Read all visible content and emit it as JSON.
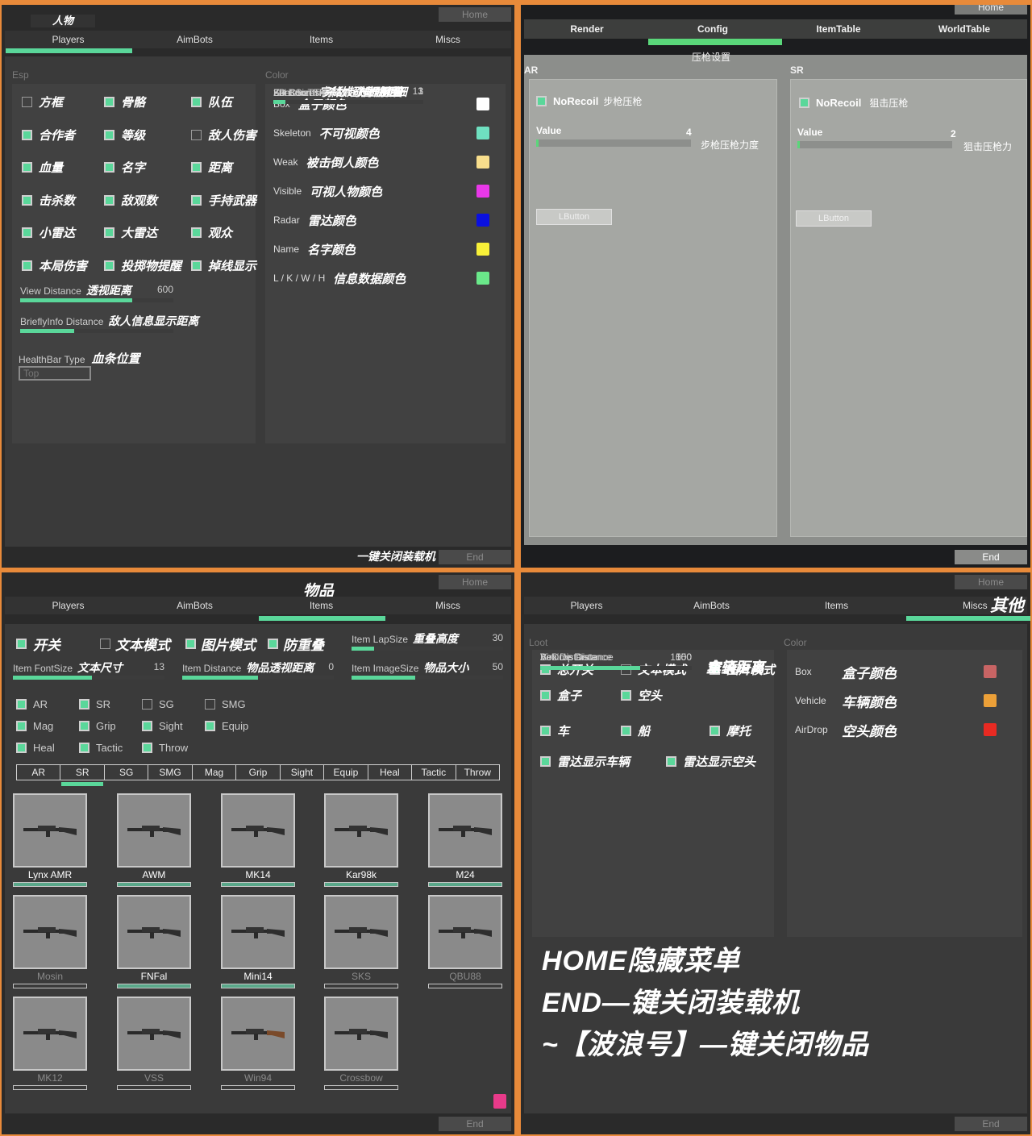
{
  "colors": {
    "accent": "#5ad79a",
    "frame": "#e88a3a",
    "background": "#2a2a2a"
  },
  "players_panel": {
    "title_cn": "人物",
    "home_label": "Home",
    "end_label": "End",
    "end_hint_cn": "一键关闭装载机",
    "tabs": [
      "Players",
      "AimBots",
      "Items",
      "Misc"
    ],
    "active_tab": "Players",
    "esp_label": "Esp",
    "color_label": "Color",
    "esp_checks": [
      {
        "label": "方框",
        "checked": false
      },
      {
        "label": "骨骼",
        "checked": true
      },
      {
        "label": "队伍",
        "checked": true
      },
      {
        "label": "合作者",
        "checked": true
      },
      {
        "label": "等级",
        "checked": true
      },
      {
        "label": "敌人伤害",
        "checked": false
      },
      {
        "label": "血量",
        "checked": true
      },
      {
        "label": "名字",
        "checked": true
      },
      {
        "label": "距离",
        "checked": true
      },
      {
        "label": "击杀数",
        "checked": true
      },
      {
        "label": "敌观数",
        "checked": true
      },
      {
        "label": "手持武器",
        "checked": true
      },
      {
        "label": "小雷达",
        "checked": true
      },
      {
        "label": "大雷达",
        "checked": true
      },
      {
        "label": "观众",
        "checked": true
      },
      {
        "label": "本局伤害",
        "checked": true
      },
      {
        "label": "投掷物提醒",
        "checked": true
      },
      {
        "label": "掉线显示",
        "checked": true
      }
    ],
    "esp_sliders": [
      {
        "label": "View Distance",
        "label_cn": "透视距离",
        "value": "600",
        "fill": 0.73
      },
      {
        "label": "BrieflyInfo Distance",
        "label_cn": "敌人信息显示距离",
        "value": "",
        "fill": 0.35
      }
    ],
    "healthbar": {
      "label": "HealthBar Type",
      "label_cn": "血条位置",
      "value": "Top"
    },
    "color_rows": [
      {
        "label": "Box",
        "label_cn": "盒子颜色",
        "color": "#ffffff"
      },
      {
        "label": "Skeleton",
        "label_cn": "不可视颜色",
        "color": "#6fe0c0"
      },
      {
        "label": "Weak",
        "label_cn": "被击倒人颜色",
        "color": "#f8de8c"
      },
      {
        "label": "Visible",
        "label_cn": "可视人物颜色",
        "color": "#e838e8"
      },
      {
        "label": "Radar",
        "label_cn": "雷达颜色",
        "color": "#0a10e0"
      },
      {
        "label": "Name",
        "label_cn": "名字颜色",
        "color": "#f8f038"
      },
      {
        "label": "L / K / W / H",
        "label_cn": "信息数据颜色",
        "color": "#6ae88a"
      }
    ],
    "color_sliders": [
      {
        "label": "Font Size",
        "label_cn": "字体大小",
        "value": "13",
        "fill": 0.65
      },
      {
        "label": "2D Box Thickness",
        "label_cn": "方框粗细",
        "value": "1",
        "fill": 0.01
      },
      {
        "label": "Skeleton Thickness",
        "label_cn": "骨骼粗细",
        "value": "1",
        "fill": 0.01
      },
      {
        "label": "Kill Counts",
        "label_cn": "杀敌超过几预警",
        "value": "3",
        "fill": 0.08
      }
    ]
  },
  "config_panel": {
    "home_label": "Home",
    "end_label": "End",
    "tabs": [
      "Render",
      "Config",
      "ItemTable",
      "WorldTable"
    ],
    "active_tab": "Config",
    "section_cn": "压枪设置",
    "groups": [
      {
        "title": "AR",
        "check_label": "NoRecoil",
        "check_cn": "步枪压枪",
        "checked": true,
        "value_label": "Value",
        "value": "4",
        "value_cn": "步枪压枪力度",
        "fill": 0.01,
        "button": "LButton"
      },
      {
        "title": "SR",
        "check_label": "NoRecoil",
        "check_cn": "狙击压枪",
        "checked": true,
        "value_label": "Value",
        "value": "2",
        "value_cn": "狙击压枪力",
        "fill": 0.01,
        "button": "LButton"
      }
    ]
  },
  "items_panel": {
    "title_cn": "物品",
    "home_label": "Home",
    "end_label": "End",
    "tabs": [
      "Players",
      "AimBots",
      "Items",
      "Miscs"
    ],
    "active_tab": "Items",
    "top_checks": [
      {
        "label": "开关",
        "checked": true
      },
      {
        "label": "文本模式",
        "checked": false
      },
      {
        "label": "图片模式",
        "checked": true
      },
      {
        "label": "防重叠",
        "checked": true
      }
    ],
    "sliders": [
      {
        "label": "Item LapSize",
        "label_cn": "重叠高度",
        "value": "30",
        "fill": 0.15
      },
      {
        "label": "Item FontSize",
        "label_cn": "文本尺寸",
        "value": "13",
        "fill": 0.52
      },
      {
        "label": "Item Distance",
        "label_cn": "物品透视距离",
        "value": "0",
        "fill": 0.5
      },
      {
        "label": "Item ImageSize",
        "label_cn": "物品大小",
        "value": "50",
        "fill": 0.42
      }
    ],
    "category_checks": [
      {
        "label": "AR",
        "checked": true
      },
      {
        "label": "SR",
        "checked": true
      },
      {
        "label": "SG",
        "checked": false
      },
      {
        "label": "SMG",
        "checked": false
      },
      {
        "label": "Mag",
        "checked": true
      },
      {
        "label": "Grip",
        "checked": true
      },
      {
        "label": "Sight",
        "checked": true
      },
      {
        "label": "Equip",
        "checked": true
      },
      {
        "label": "Heal",
        "checked": true
      },
      {
        "label": "Tactic",
        "checked": true
      },
      {
        "label": "Throw",
        "checked": true
      }
    ],
    "category_tabs": [
      "AR",
      "SR",
      "SG",
      "SMG",
      "Mag",
      "Grip",
      "Sight",
      "Equip",
      "Heal",
      "Tactic",
      "Throw"
    ],
    "active_category": "SR",
    "weapons": [
      {
        "name": "Lynx AMR",
        "enabled": true
      },
      {
        "name": "AWM",
        "enabled": true
      },
      {
        "name": "MK14",
        "enabled": true
      },
      {
        "name": "Kar98k",
        "enabled": true
      },
      {
        "name": "M24",
        "enabled": true
      },
      {
        "name": "Mosin",
        "enabled": false
      },
      {
        "name": "FNFal",
        "enabled": true
      },
      {
        "name": "Mini14",
        "enabled": true
      },
      {
        "name": "SKS",
        "enabled": false
      },
      {
        "name": "QBU88",
        "enabled": false
      },
      {
        "name": "MK12",
        "enabled": false
      },
      {
        "name": "VSS",
        "enabled": false
      },
      {
        "name": "Win94",
        "enabled": false
      },
      {
        "name": "Crossbow",
        "enabled": false
      }
    ],
    "picker_color": "#e83a8a"
  },
  "misc_panel": {
    "title_cn": "其他",
    "home_label": "Home",
    "end_label": "End",
    "tabs": [
      "Players",
      "AimBots",
      "Items",
      "Miscs"
    ],
    "active_tab": "Miscs",
    "loot_label": "Loot",
    "color_label": "Color",
    "loot_checks": [
      {
        "label": "总开关",
        "checked": true
      },
      {
        "label": "文本模式",
        "checked": false
      },
      {
        "label": "图片模式",
        "checked": true
      },
      {
        "label": "盒子",
        "checked": true
      },
      {
        "label": "空头",
        "checked": true
      },
      {
        "label": "车",
        "checked": true
      },
      {
        "label": "船",
        "checked": true
      },
      {
        "label": "摩托",
        "checked": true
      },
      {
        "label": "雷达显示车辆",
        "checked": true
      },
      {
        "label": "雷达显示空头",
        "checked": true
      }
    ],
    "sliders": [
      {
        "label": "Box Distance",
        "label_cn": "盒子距离",
        "value": "150",
        "fill": 0.74
      },
      {
        "label": "Vehicle Distance",
        "label_cn": "车辆距离",
        "value": "500",
        "fill": 1.0
      },
      {
        "label": "AirDrop Distance",
        "label_cn": "空头距离",
        "value": "1000",
        "fill": 0.66
      }
    ],
    "color_rows": [
      {
        "label": "Box",
        "label_cn": "盒子颜色",
        "color": "#c86464"
      },
      {
        "label": "Vehicle",
        "label_cn": "车辆颜色",
        "color": "#eca038"
      },
      {
        "label": "AirDrop",
        "label_cn": "空头颜色",
        "color": "#e82a22"
      }
    ],
    "notices": [
      "HOME隐藏菜单",
      "END—键关闭装载机",
      "~【波浪号】—键关闭物品"
    ]
  }
}
